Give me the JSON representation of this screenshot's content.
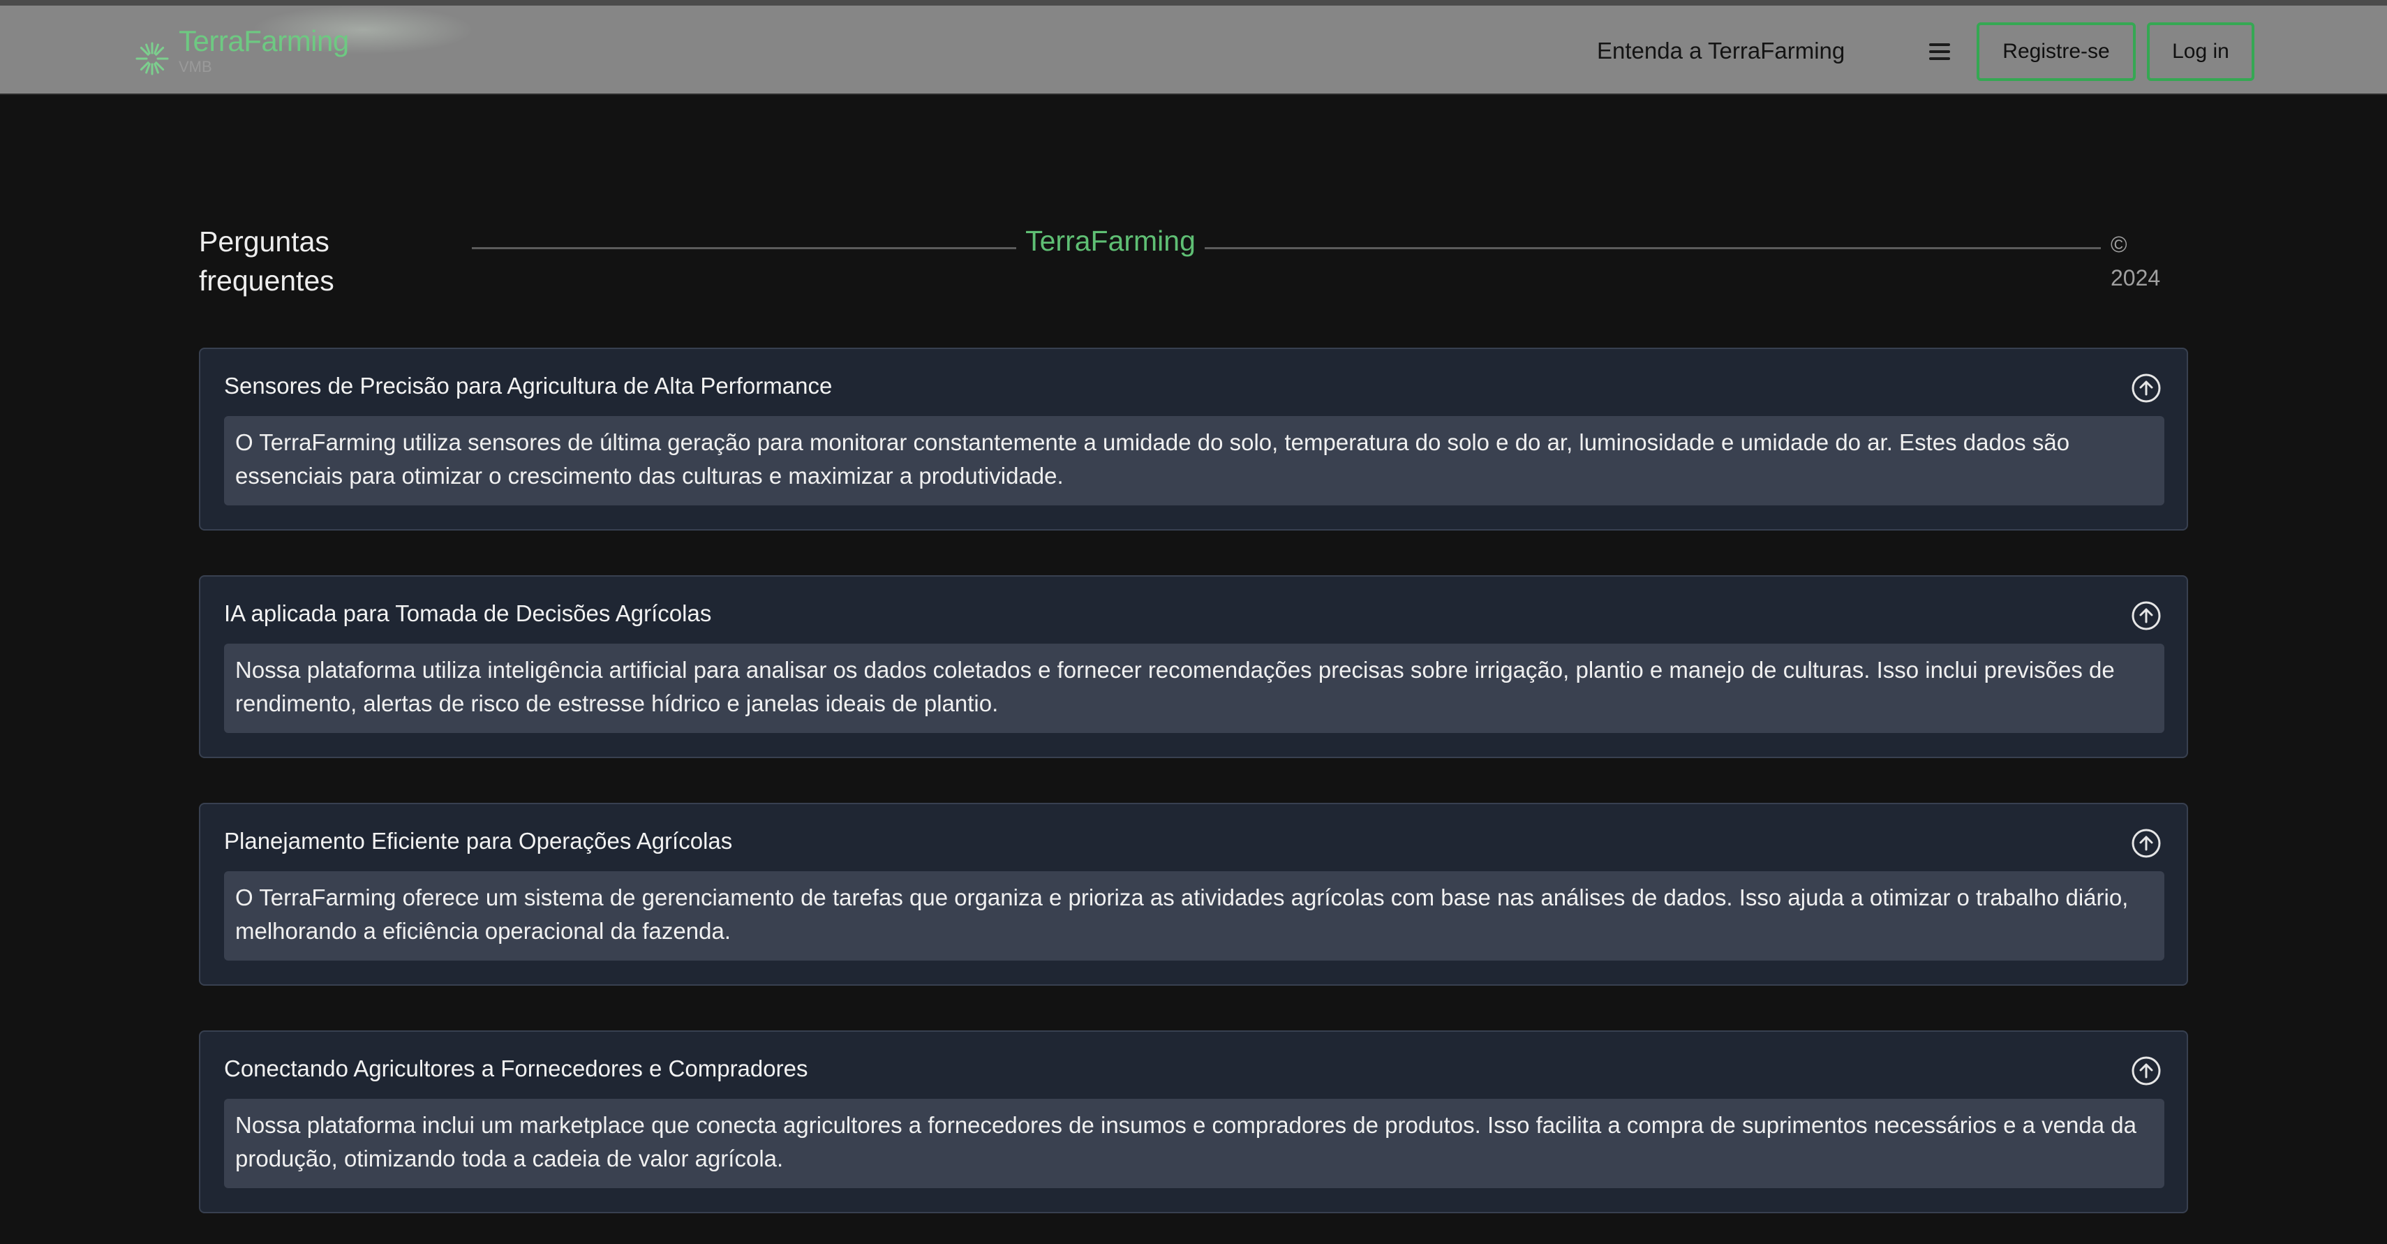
{
  "navbar": {
    "brand_name": "TerraFarming",
    "brand_sub": "VMB",
    "link": "Entenda a TerraFarming",
    "register_label": "Registre-se",
    "login_label": "Log in"
  },
  "section": {
    "title": "Perguntas frequentes",
    "brand": "TerraFarming",
    "copyright_symbol": "©",
    "year": "2024"
  },
  "faq": [
    {
      "question": "Sensores de Precisão para Agricultura de Alta Performance",
      "answer": "O TerraFarming utiliza sensores de última geração para monitorar constantemente a umidade do solo, temperatura do solo e do ar, luminosidade e umidade do ar. Estes dados são essenciais para otimizar o crescimento das culturas e maximizar a produtividade."
    },
    {
      "question": "IA aplicada para Tomada de Decisões Agrícolas",
      "answer": "Nossa plataforma utiliza inteligência artificial para analisar os dados coletados e fornecer recomendações precisas sobre irrigação, plantio e manejo de culturas. Isso inclui previsões de rendimento, alertas de risco de estresse hídrico e janelas ideais de plantio."
    },
    {
      "question": "Planejamento Eficiente para Operações Agrícolas",
      "answer": "O TerraFarming oferece um sistema de gerenciamento de tarefas que organiza e prioriza as atividades agrícolas com base nas análises de dados. Isso ajuda a otimizar o trabalho diário, melhorando a eficiência operacional da fazenda."
    },
    {
      "question": "Conectando Agricultores a Fornecedores e Compradores",
      "answer": "Nossa plataforma inclui um marketplace que conecta agricultores a fornecedores de insumos e compradores de produtos. Isso facilita a compra de suprimentos necessários e a venda da produção, otimizando toda a cadeia de valor agrícola."
    }
  ],
  "icons": {
    "logo": "sunburst-logo-icon",
    "menu": "hamburger-menu-icon",
    "toggle": "arrow-up-circle-icon"
  },
  "colors": {
    "brand_green": "#6ec982",
    "button_border": "#35a853",
    "navbar_bg": "#868686",
    "page_bg": "#121212",
    "card_bg": "#1f2633",
    "answer_bg": "#3a4150"
  }
}
